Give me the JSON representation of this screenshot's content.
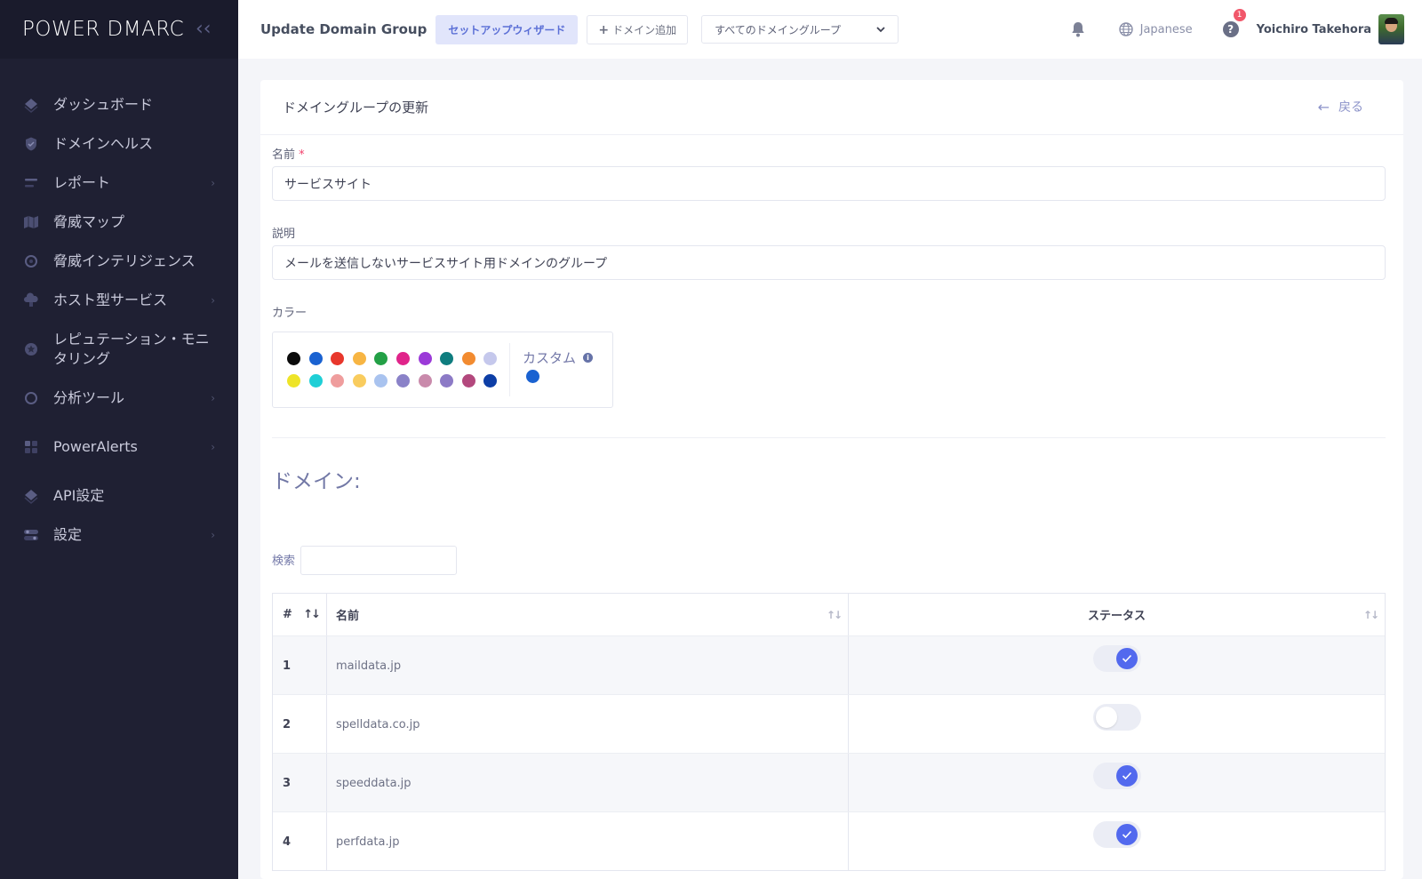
{
  "sidebar": {
    "logo": "POWER DMARC",
    "collapse_icon": "double-chevron-left-icon",
    "items": [
      {
        "label": "ダッシュボード",
        "icon": "diamond-layers-icon",
        "has_children": false
      },
      {
        "label": "ドメインヘルス",
        "icon": "shield-check-icon",
        "has_children": false
      },
      {
        "label": "レポート",
        "icon": "report-lines-icon",
        "has_children": true
      },
      {
        "label": "脅威マップ",
        "icon": "map-icon",
        "has_children": false
      },
      {
        "label": "脅威インテリジェンス",
        "icon": "radar-circle-icon",
        "has_children": false
      },
      {
        "label": "ホスト型サービス",
        "icon": "cloud-server-icon",
        "has_children": true
      },
      {
        "label": "レピュテーション・モニタリング",
        "icon": "badge-star-icon",
        "has_children": false
      },
      {
        "label": "分析ツール",
        "icon": "analysis-circle-icon",
        "has_children": true
      },
      {
        "label": "PowerAlerts",
        "icon": "alerts-grid-icon",
        "has_children": true
      },
      {
        "label": "API設定",
        "icon": "api-diamond-icon",
        "has_children": false
      },
      {
        "label": "設定",
        "icon": "settings-toggles-icon",
        "has_children": true
      }
    ]
  },
  "header": {
    "title": "Update Domain Group",
    "wizard_label": "セットアップウィザード",
    "add_domain_label": "ドメイン追加",
    "group_select_value": "すべてのドメイングループ",
    "language": "Japanese",
    "help_badge": "1",
    "user_name": "Yoichiro Takehora"
  },
  "form": {
    "card_title": "ドメイングループの更新",
    "back_label": "戻る",
    "name_label": "名前",
    "required_mark": "*",
    "name_value": "サービスサイト",
    "description_label": "説明",
    "description_value": "メールを送信しないサービスサイト用ドメインのグループ",
    "color_label": "カラー",
    "custom_label": "カスタム",
    "info_mark": "i",
    "swatches": [
      "#0b0b0b",
      "#1a62d1",
      "#e8372c",
      "#f7b543",
      "#23a046",
      "#e0248a",
      "#9b3ad8",
      "#0f7d7f",
      "#f28b30",
      "#c5c8ec",
      "#eee428",
      "#1fcfd6",
      "#ef9d9d",
      "#f9cc5e",
      "#a9c3ef",
      "#8a82c8",
      "#c98aab",
      "#8c7ac6",
      "#b3487d",
      "#0d3ea6"
    ],
    "custom_color": "#1a62d1"
  },
  "domains": {
    "heading": "ドメイン:",
    "search_label": "検索",
    "columns": {
      "num": "#",
      "name": "名前",
      "status": "ステータス"
    },
    "rows": [
      {
        "num": "1",
        "name": "maildata.jp",
        "enabled": true
      },
      {
        "num": "2",
        "name": "spelldata.co.jp",
        "enabled": false
      },
      {
        "num": "3",
        "name": "speeddata.jp",
        "enabled": true
      },
      {
        "num": "4",
        "name": "perfdata.jp",
        "enabled": true
      }
    ]
  },
  "colors": {
    "sidebar_bg": "#1f2033",
    "accent": "#5269ee",
    "badge": "#f1576a"
  }
}
